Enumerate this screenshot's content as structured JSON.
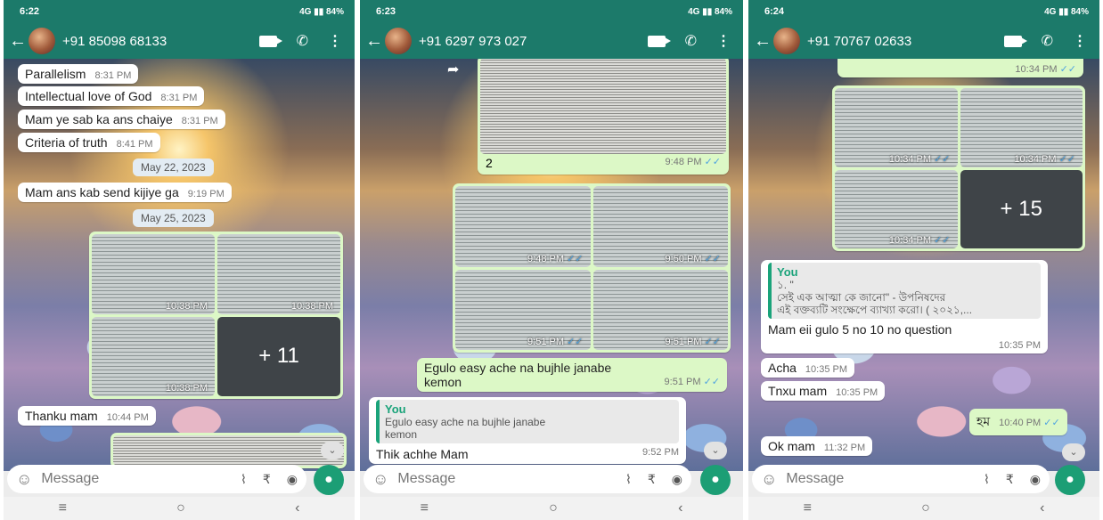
{
  "panel1": {
    "time": "6:22",
    "battery": "84%",
    "signal": "4G",
    "contact": "+91 85098 68133",
    "msgs": [
      {
        "text": "Parallelism",
        "time": "8:31 PM"
      },
      {
        "text": "Intellectual love of God",
        "time": "8:31 PM"
      },
      {
        "text": "Mam ye sab ka ans chaiye",
        "time": "8:31 PM"
      },
      {
        "text": "Criteria of truth",
        "time": "8:41 PM"
      },
      {
        "text": "Mam ans kab send kijiye ga",
        "time": "9:19 PM"
      },
      {
        "text": "Thanku mam",
        "time": "10:44 PM"
      }
    ],
    "dates": [
      "May 22, 2023",
      "May 25, 2023"
    ],
    "media_times": [
      "10:38 PM",
      "10:38 PM",
      "10:38 PM"
    ],
    "media_more": "+ 11",
    "placeholder": "Message"
  },
  "panel2": {
    "time": "6:23",
    "battery": "84%",
    "signal": "4G",
    "contact": "+91 6297 973 027",
    "doc_caption": "2",
    "doc_time": "9:48 PM",
    "media_times": [
      "9:48 PM",
      "9:50 PM",
      "9:51 PM",
      "9:51 PM"
    ],
    "out_msg": {
      "text1": "Egulo easy ache na bujhle janabe",
      "text2": "kemon",
      "time": "9:51 PM"
    },
    "reply": {
      "author": "You",
      "quote1": "Egulo easy ache na bujhle janabe",
      "quote2": "kemon",
      "text": "Thik achhe Mam",
      "time": "9:52 PM"
    },
    "placeholder": "Message"
  },
  "panel3": {
    "time": "6:24",
    "battery": "84%",
    "signal": "4G",
    "contact": "+91 70767 02633",
    "top_time": "10:34 PM",
    "media_times": [
      "10:34 PM",
      "10:34 PM",
      "10:34 PM"
    ],
    "media_more": "+ 15",
    "reply": {
      "author": "You",
      "quote1": "১.  \"",
      "quote2": "সেই এক আত্মা কে জানো\" - উপনিষদের",
      "quote3": "এই বক্তব্যটি সংক্ষেপে ব্যাখ্যা করো। ( ২০২১,...",
      "text": "Mam eii gulo 5 no 10 no question",
      "time": "10:35 PM"
    },
    "msgs": [
      {
        "text": "Acha",
        "time": "10:35 PM"
      },
      {
        "text": "Tnxu mam",
        "time": "10:35 PM"
      }
    ],
    "out_msg": {
      "text": "হম",
      "time": "10:40 PM"
    },
    "last_msg": {
      "text": "Ok mam",
      "time": "11:32 PM"
    },
    "placeholder": "Message"
  },
  "icons": {
    "back": "arrow-left-icon",
    "video": "video-call-icon",
    "phone": "phone-icon",
    "menu": "more-vert-icon"
  }
}
